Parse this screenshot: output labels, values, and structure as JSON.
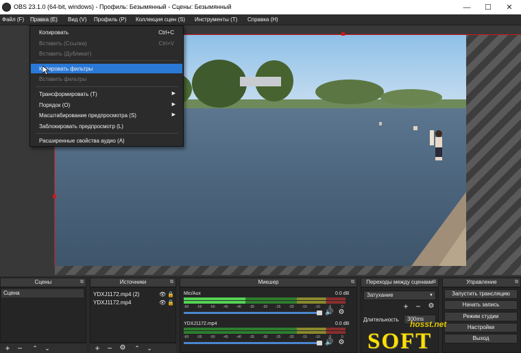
{
  "window": {
    "title": "OBS 23.1.0 (64-bit, windows) - Профиль: Безымянный - Сцены: Безымянный"
  },
  "menubar": [
    "Файл (F)",
    "Правка (E)",
    "Вид (V)",
    "Профиль (P)",
    "Коллекция сцен (S)",
    "Инструменты (T)",
    "Справка (H)"
  ],
  "edit_menu": {
    "copy": {
      "label": "Копировать",
      "shortcut": "Ctrl+C"
    },
    "paste_ref": {
      "label": "Вставить (Ссылка)",
      "shortcut": "Ctrl+V"
    },
    "paste_dup": {
      "label": "Вставить (Дубликат)"
    },
    "copy_filters": {
      "label": "Копировать фильтры"
    },
    "paste_filters": {
      "label": "Вставить фильтры"
    },
    "transform": {
      "label": "Трансформировать (T)"
    },
    "order": {
      "label": "Порядок (O)"
    },
    "preview_scale": {
      "label": "Масштабирование предпросмотра (S)"
    },
    "lock_preview": {
      "label": "Заблокировать предпросмотр (L)"
    },
    "adv_audio": {
      "label": "Расширенные свойства аудио (A)"
    }
  },
  "docks": {
    "scenes": {
      "title": "Сцены",
      "items": [
        "Сцена"
      ]
    },
    "sources": {
      "title": "Источники",
      "items": [
        "YDXJ1172.mp4 (2)",
        "YDXJ1172.mp4"
      ]
    },
    "mixer": {
      "title": "Микшер",
      "channels": [
        {
          "name": "Mic/Aux",
          "db": "0.0 dB",
          "level": 0.38
        },
        {
          "name": "YDXJ1172.mp4",
          "db": "0.0 dB",
          "level": 0.0
        }
      ],
      "scale": [
        "-60",
        "-55",
        "-50",
        "-45",
        "-40",
        "-35",
        "-30",
        "-25",
        "-20",
        "-15",
        "-10",
        "-5",
        "0"
      ]
    },
    "transitions": {
      "title": "Переходы между сценами",
      "selected": "Затухание",
      "duration_label": "Длительность",
      "duration_value": "300ms"
    },
    "controls": {
      "title": "Управление",
      "buttons": [
        "Запустить трансляцию",
        "Начать запись",
        "Режим студии",
        "Настройки",
        "Выход"
      ]
    }
  },
  "watermark": {
    "big": "SOFT",
    "small": "hosst.net"
  },
  "colors": {
    "accent": "#2b79d7",
    "selection": "#d01818",
    "watermark": "#ffe000"
  }
}
